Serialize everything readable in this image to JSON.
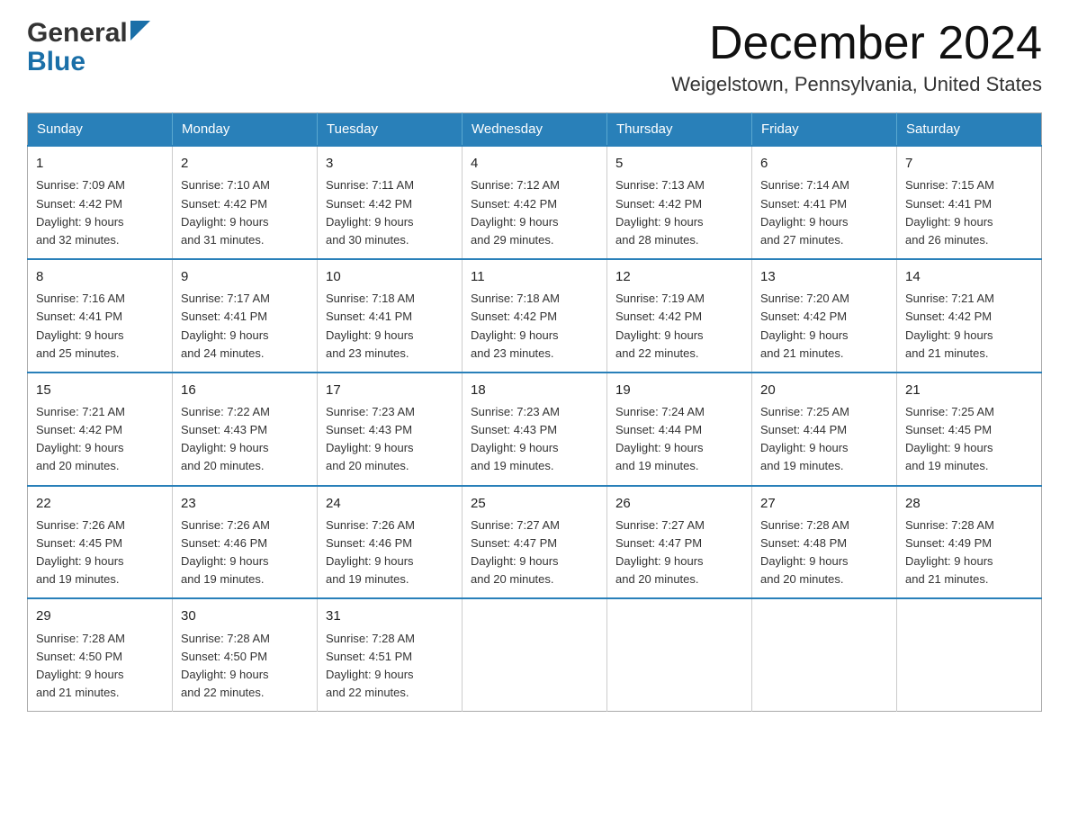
{
  "header": {
    "logo_line1": "General",
    "logo_line2": "Blue",
    "month_title": "December 2024",
    "location": "Weigelstown, Pennsylvania, United States"
  },
  "weekdays": [
    "Sunday",
    "Monday",
    "Tuesday",
    "Wednesday",
    "Thursday",
    "Friday",
    "Saturday"
  ],
  "weeks": [
    [
      {
        "day": "1",
        "sunrise": "7:09 AM",
        "sunset": "4:42 PM",
        "daylight": "9 hours and 32 minutes."
      },
      {
        "day": "2",
        "sunrise": "7:10 AM",
        "sunset": "4:42 PM",
        "daylight": "9 hours and 31 minutes."
      },
      {
        "day": "3",
        "sunrise": "7:11 AM",
        "sunset": "4:42 PM",
        "daylight": "9 hours and 30 minutes."
      },
      {
        "day": "4",
        "sunrise": "7:12 AM",
        "sunset": "4:42 PM",
        "daylight": "9 hours and 29 minutes."
      },
      {
        "day": "5",
        "sunrise": "7:13 AM",
        "sunset": "4:42 PM",
        "daylight": "9 hours and 28 minutes."
      },
      {
        "day": "6",
        "sunrise": "7:14 AM",
        "sunset": "4:41 PM",
        "daylight": "9 hours and 27 minutes."
      },
      {
        "day": "7",
        "sunrise": "7:15 AM",
        "sunset": "4:41 PM",
        "daylight": "9 hours and 26 minutes."
      }
    ],
    [
      {
        "day": "8",
        "sunrise": "7:16 AM",
        "sunset": "4:41 PM",
        "daylight": "9 hours and 25 minutes."
      },
      {
        "day": "9",
        "sunrise": "7:17 AM",
        "sunset": "4:41 PM",
        "daylight": "9 hours and 24 minutes."
      },
      {
        "day": "10",
        "sunrise": "7:18 AM",
        "sunset": "4:41 PM",
        "daylight": "9 hours and 23 minutes."
      },
      {
        "day": "11",
        "sunrise": "7:18 AM",
        "sunset": "4:42 PM",
        "daylight": "9 hours and 23 minutes."
      },
      {
        "day": "12",
        "sunrise": "7:19 AM",
        "sunset": "4:42 PM",
        "daylight": "9 hours and 22 minutes."
      },
      {
        "day": "13",
        "sunrise": "7:20 AM",
        "sunset": "4:42 PM",
        "daylight": "9 hours and 21 minutes."
      },
      {
        "day": "14",
        "sunrise": "7:21 AM",
        "sunset": "4:42 PM",
        "daylight": "9 hours and 21 minutes."
      }
    ],
    [
      {
        "day": "15",
        "sunrise": "7:21 AM",
        "sunset": "4:42 PM",
        "daylight": "9 hours and 20 minutes."
      },
      {
        "day": "16",
        "sunrise": "7:22 AM",
        "sunset": "4:43 PM",
        "daylight": "9 hours and 20 minutes."
      },
      {
        "day": "17",
        "sunrise": "7:23 AM",
        "sunset": "4:43 PM",
        "daylight": "9 hours and 20 minutes."
      },
      {
        "day": "18",
        "sunrise": "7:23 AM",
        "sunset": "4:43 PM",
        "daylight": "9 hours and 19 minutes."
      },
      {
        "day": "19",
        "sunrise": "7:24 AM",
        "sunset": "4:44 PM",
        "daylight": "9 hours and 19 minutes."
      },
      {
        "day": "20",
        "sunrise": "7:25 AM",
        "sunset": "4:44 PM",
        "daylight": "9 hours and 19 minutes."
      },
      {
        "day": "21",
        "sunrise": "7:25 AM",
        "sunset": "4:45 PM",
        "daylight": "9 hours and 19 minutes."
      }
    ],
    [
      {
        "day": "22",
        "sunrise": "7:26 AM",
        "sunset": "4:45 PM",
        "daylight": "9 hours and 19 minutes."
      },
      {
        "day": "23",
        "sunrise": "7:26 AM",
        "sunset": "4:46 PM",
        "daylight": "9 hours and 19 minutes."
      },
      {
        "day": "24",
        "sunrise": "7:26 AM",
        "sunset": "4:46 PM",
        "daylight": "9 hours and 19 minutes."
      },
      {
        "day": "25",
        "sunrise": "7:27 AM",
        "sunset": "4:47 PM",
        "daylight": "9 hours and 20 minutes."
      },
      {
        "day": "26",
        "sunrise": "7:27 AM",
        "sunset": "4:47 PM",
        "daylight": "9 hours and 20 minutes."
      },
      {
        "day": "27",
        "sunrise": "7:28 AM",
        "sunset": "4:48 PM",
        "daylight": "9 hours and 20 minutes."
      },
      {
        "day": "28",
        "sunrise": "7:28 AM",
        "sunset": "4:49 PM",
        "daylight": "9 hours and 21 minutes."
      }
    ],
    [
      {
        "day": "29",
        "sunrise": "7:28 AM",
        "sunset": "4:50 PM",
        "daylight": "9 hours and 21 minutes."
      },
      {
        "day": "30",
        "sunrise": "7:28 AM",
        "sunset": "4:50 PM",
        "daylight": "9 hours and 22 minutes."
      },
      {
        "day": "31",
        "sunrise": "7:28 AM",
        "sunset": "4:51 PM",
        "daylight": "9 hours and 22 minutes."
      },
      null,
      null,
      null,
      null
    ]
  ],
  "labels": {
    "sunrise": "Sunrise:",
    "sunset": "Sunset:",
    "daylight": "Daylight:"
  }
}
